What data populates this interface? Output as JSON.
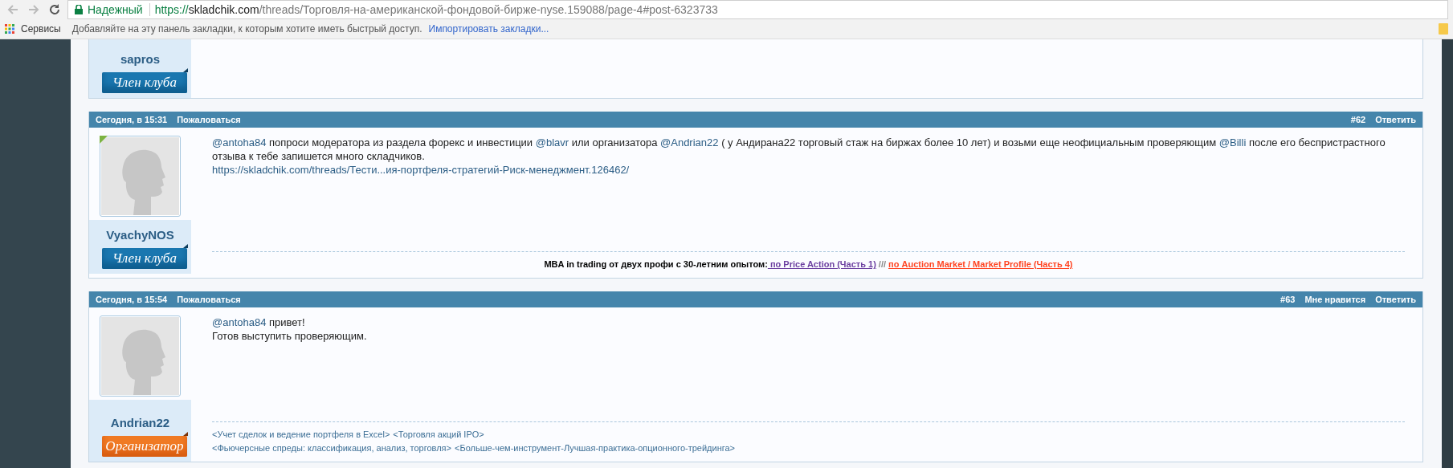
{
  "browser": {
    "security_label": "Надежный",
    "url": {
      "scheme": "https://",
      "host": "skladchik.com",
      "path": "/threads/Торговля-на-американской-фондовой-бирже-nyse.159088/page-4#post-6323733"
    }
  },
  "bookmarks_bar": {
    "apps_label": "Сервисы",
    "hint": "Добавляйте на эту панель закладки, к которым хотите иметь быстрый доступ.",
    "import_link": "Импортировать закладки..."
  },
  "previous_post": {
    "username": "sapros",
    "rank": {
      "label": "Член клуба",
      "kind": "member"
    }
  },
  "posts": [
    {
      "date": "Сегодня, в 15:31",
      "report": "Пожаловаться",
      "number": "#62",
      "actions": [
        "Ответить"
      ],
      "username": "VyachyNOS",
      "online": true,
      "rank": {
        "label": "Член клуба",
        "kind": "member"
      },
      "message": [
        [
          {
            "kind": "mention",
            "text": "@antoha84"
          },
          {
            "kind": "text",
            "text": " попроси модератора из раздела форекс и инвестиции "
          },
          {
            "kind": "mention",
            "text": "@blavr"
          },
          {
            "kind": "text",
            "text": " или организатора "
          },
          {
            "kind": "mention",
            "text": "@Andrian22"
          },
          {
            "kind": "text",
            "text": " ( у Андирана22 торговый стаж на биржах более 10 лет) и возьми еще неофициальным проверяющим "
          },
          {
            "kind": "mention",
            "text": "@Billi"
          },
          {
            "kind": "text",
            "text": " после его беспристрастного отзыва к тебе запишется много складчиков."
          }
        ],
        [
          {
            "kind": "link",
            "text": "https://skladchik.com/threads/Тести...ия-портфеля-стратегий-Риск-менеджмент.126462/"
          }
        ]
      ],
      "signature": {
        "kind": "banner",
        "lines": [
          [
            {
              "kind": "bold",
              "text": "MBA in trading от двух профи с 30-летним опытом:"
            },
            {
              "kind": "link",
              "color": "#6b3fa0",
              "text": " по Price Action (Часть 1)"
            },
            {
              "kind": "separator",
              "text": " /// "
            },
            {
              "kind": "link",
              "color": "#ff4422",
              "text": "по Auction Market / Market Profile (Часть 4)"
            }
          ]
        ]
      }
    },
    {
      "date": "Сегодня, в 15:54",
      "report": "Пожаловаться",
      "number": "#63",
      "actions": [
        "Мне нравится",
        "Ответить"
      ],
      "username": "Andrian22",
      "online": false,
      "rank": {
        "label": "Организатор",
        "kind": "organizer"
      },
      "message": [
        [
          {
            "kind": "mention",
            "text": "@antoha84"
          },
          {
            "kind": "text",
            "text": " привет!"
          }
        ],
        [
          {
            "kind": "text",
            "text": "Готов выступить проверяющим."
          }
        ]
      ],
      "signature": {
        "kind": "links",
        "lines": [
          [
            {
              "kind": "link",
              "color": "#3d6f96",
              "text": "<Учет сделок и ведение портфеля в Excel>"
            },
            {
              "kind": "link",
              "color": "#3d6f96",
              "text": "<Торговля акций IPO>"
            }
          ],
          [
            {
              "kind": "link",
              "color": "#3d6f96",
              "text": "<Фьючерсные спреды: классификация, анализ, торговля>"
            },
            {
              "kind": "link",
              "color": "#3d6f96",
              "text": "<Больше-чем-инструмент-Лучшая-практика-опционного-трейдинга>"
            }
          ]
        ]
      }
    }
  ]
}
